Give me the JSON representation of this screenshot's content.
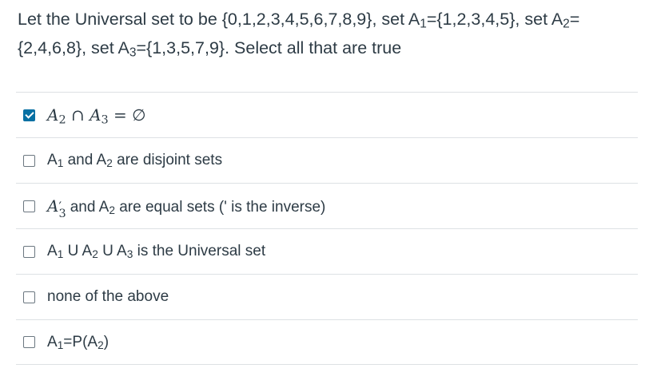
{
  "question": {
    "p1": "Let the Universal set to be {0,1,2,3,4,5,6,7,8,9}, set A",
    "p1_sub": "1",
    "p2": "={1,2,3,4,5}, set A",
    "p2_sub": "2",
    "p3": "= {2,4,6,8}, set A",
    "p3_sub": "3",
    "p4": "={1,3,5,7,9}. Select all that are true"
  },
  "options": [
    {
      "checked": true,
      "math_a": "A",
      "math_a_sub": "2",
      "math_op": " ∩ ",
      "math_b": "A",
      "math_b_sub": "3",
      "math_rest": " = ∅"
    },
    {
      "checked": false,
      "t1": "A",
      "s1": "1",
      "t2": " and A",
      "s2": "2",
      "t3": " are disjoint sets"
    },
    {
      "checked": false,
      "math_a": "A",
      "math_a_sup": "′",
      "math_a_sub": "3",
      "t2": " and A",
      "s2": "2",
      "t3": " are equal sets (' is the inverse)"
    },
    {
      "checked": false,
      "t1": "A",
      "s1": "1",
      "t2": " U A",
      "s2": "2",
      "t3": " U A",
      "s3": "3",
      "t4": " is the Universal set"
    },
    {
      "checked": false,
      "t1": "none of the above"
    },
    {
      "checked": false,
      "t1": "A",
      "s1": "1",
      "t2": "=P(A",
      "s2": "2",
      "t3": ")"
    }
  ],
  "colors": {
    "accent": "#0770a3",
    "text": "#2d3b45",
    "divider": "#dde1e4"
  }
}
